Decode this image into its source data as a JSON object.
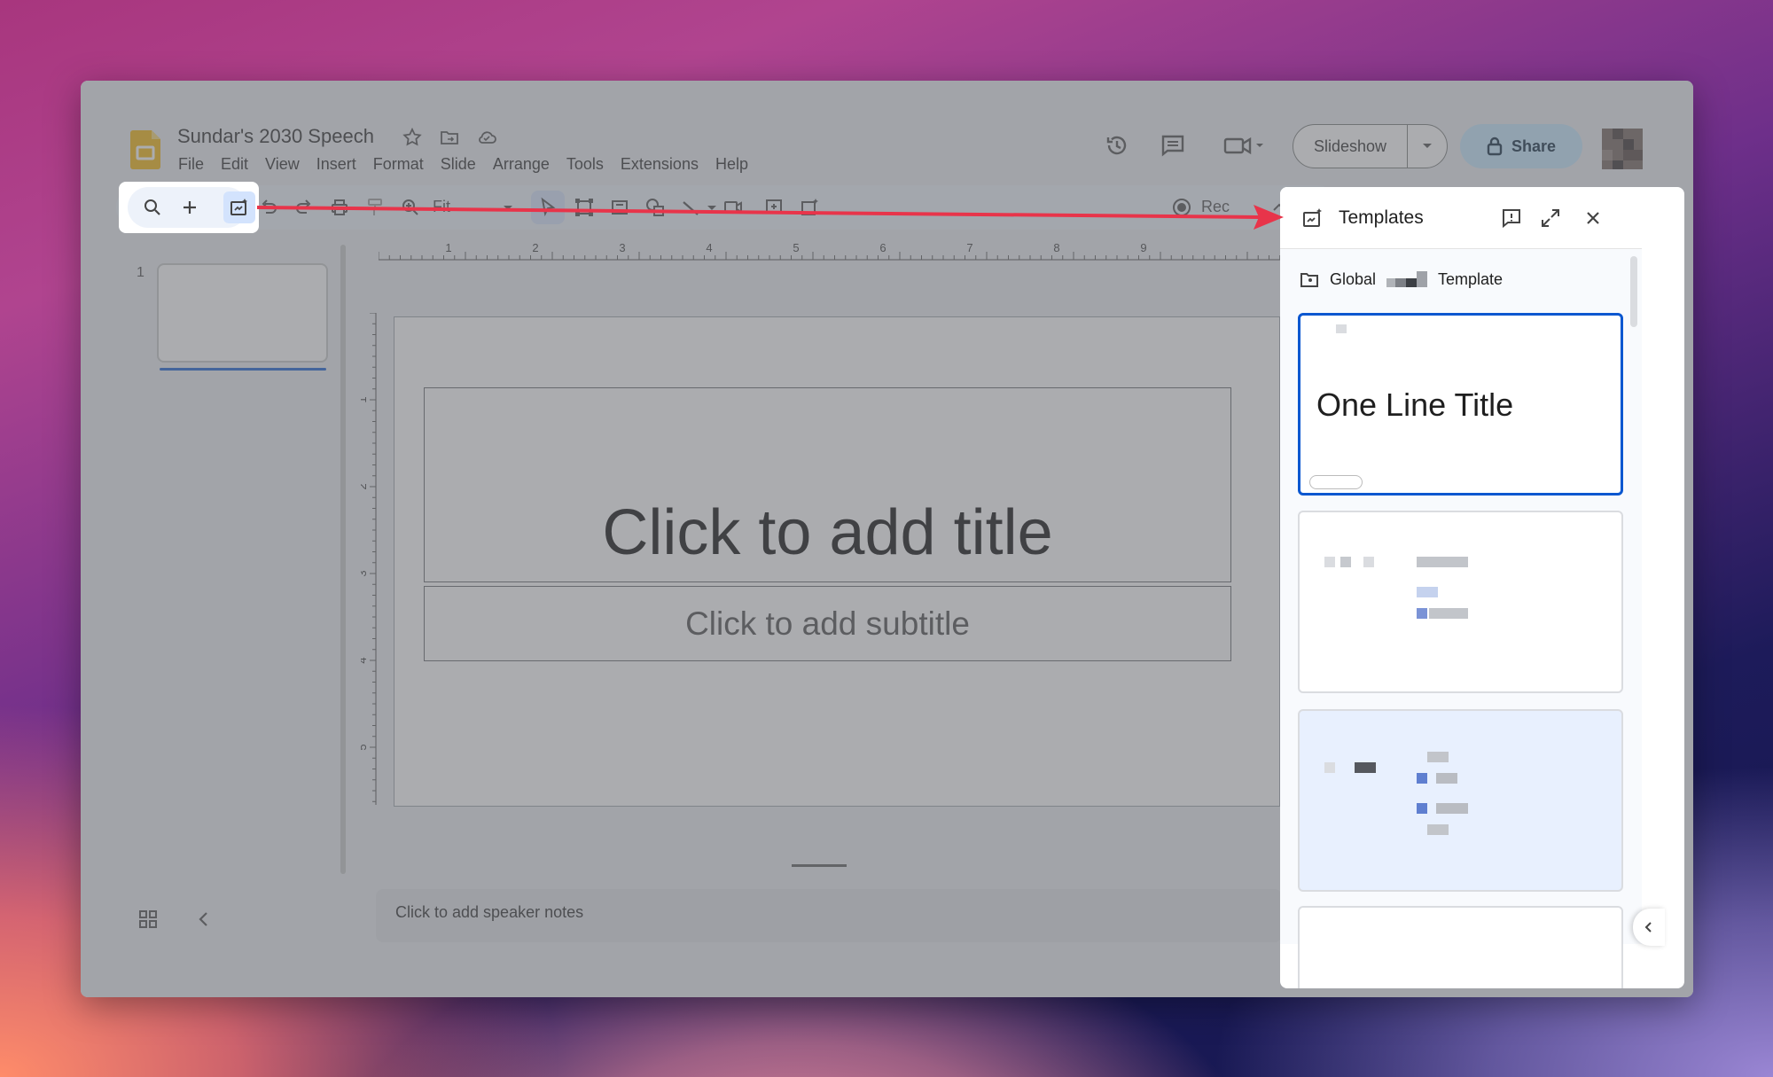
{
  "doc": {
    "title": "Sundar's 2030 Speech",
    "menu": [
      "File",
      "Edit",
      "View",
      "Insert",
      "Format",
      "Slide",
      "Arrange",
      "Tools",
      "Extensions",
      "Help"
    ]
  },
  "header": {
    "slideshow_label": "Slideshow",
    "share_label": "Share"
  },
  "toolbar": {
    "zoom_label": "Fit",
    "rec_label": "Rec"
  },
  "ruler": {
    "h_ticks": [
      "1",
      "2",
      "3",
      "4",
      "5",
      "6",
      "7",
      "8",
      "9"
    ],
    "v_ticks": [
      "1",
      "2",
      "3",
      "4",
      "5"
    ]
  },
  "filmstrip": {
    "slide_number": "1"
  },
  "slide": {
    "title_placeholder": "Click to add title",
    "subtitle_placeholder": "Click to add subtitle"
  },
  "notes": {
    "placeholder": "Click to add speaker notes"
  },
  "templates_panel": {
    "title": "Templates",
    "breadcrumb_root": "Global",
    "breadcrumb_leaf": "Template",
    "cards": [
      {
        "title": "One Line Title"
      }
    ]
  },
  "colors": {
    "accent_blue": "#0b57d0",
    "share_bg": "#c2e7ff",
    "arrow_red": "#e8344a",
    "slides_yellow": "#f4b400"
  }
}
